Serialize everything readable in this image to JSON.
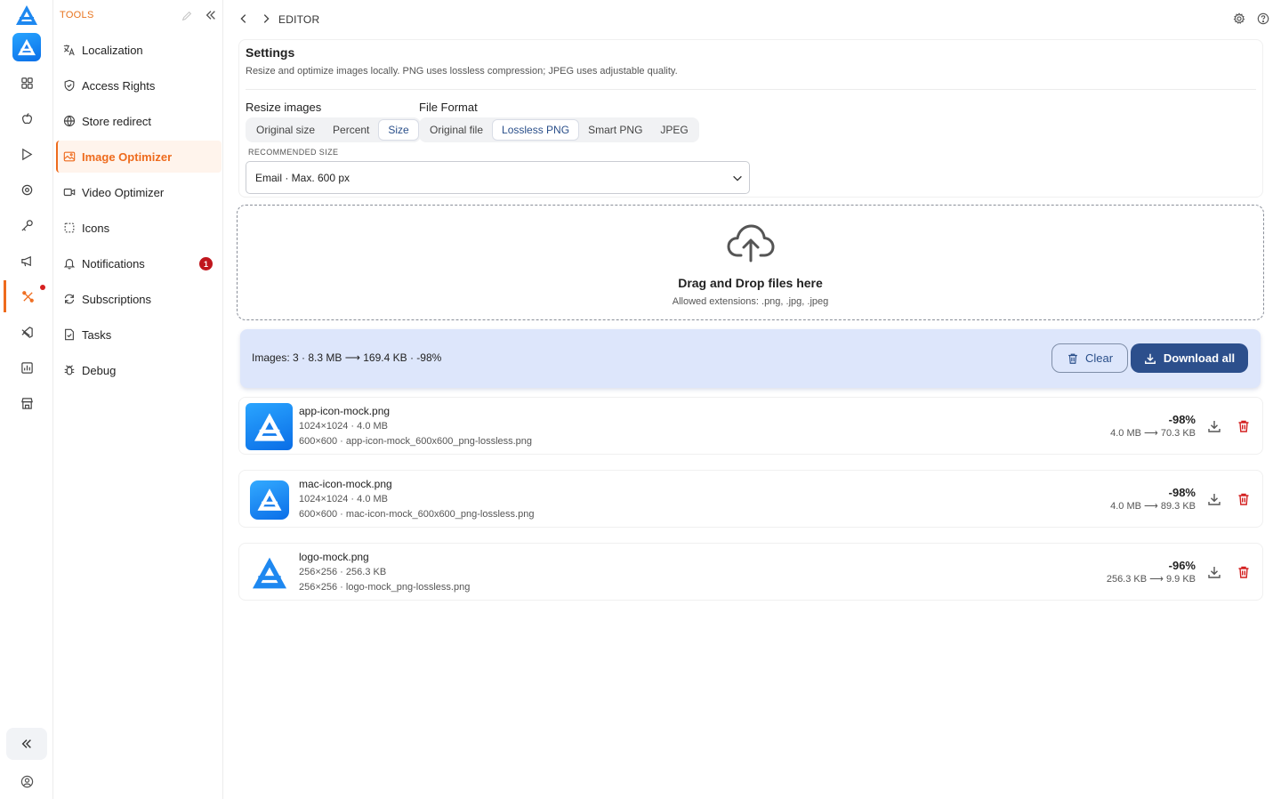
{
  "sidebar": {
    "heading": "TOOLS",
    "items": [
      {
        "label": "Localization",
        "icon": "translate-icon"
      },
      {
        "label": "Access Rights",
        "icon": "shield-icon"
      },
      {
        "label": "Store redirect",
        "icon": "globe-icon"
      },
      {
        "label": "Image Optimizer",
        "icon": "image-icon",
        "active": true
      },
      {
        "label": "Video Optimizer",
        "icon": "video-icon"
      },
      {
        "label": "Icons",
        "icon": "dashed-square-icon"
      },
      {
        "label": "Notifications",
        "icon": "bell-icon",
        "badge": "1"
      },
      {
        "label": "Subscriptions",
        "icon": "refresh-icon"
      },
      {
        "label": "Tasks",
        "icon": "task-file-icon"
      },
      {
        "label": "Debug",
        "icon": "bug-icon"
      }
    ]
  },
  "topbar": {
    "breadcrumb": "EDITOR"
  },
  "settings": {
    "title": "Settings",
    "description": "Resize and optimize images locally. PNG uses lossless compression; JPEG uses adjustable quality.",
    "resize": {
      "label": "Resize images",
      "options": [
        "Original size",
        "Percent",
        "Size"
      ],
      "selected": "Size"
    },
    "format": {
      "label": "File Format",
      "options": [
        "Original file",
        "Lossless PNG",
        "Smart PNG",
        "JPEG"
      ],
      "selected": "Lossless PNG"
    },
    "recommended": {
      "label": "RECOMMENDED SIZE",
      "value": "Email · Max. 600 px"
    }
  },
  "dropzone": {
    "title": "Drag and Drop files here",
    "subtitle": "Allowed extensions: .png, .jpg, .jpeg"
  },
  "summary": {
    "text": "Images: 3 · 8.3 MB ⟶ 169.4 KB · -98%",
    "clear_label": "Clear",
    "download_label": "Download all"
  },
  "files": [
    {
      "name": "app-icon-mock.png",
      "meta": "1024×1024 · 4.0 MB",
      "output": "600×600 · app-icon-mock_600x600_png-lossless.png",
      "percent": "-98%",
      "sizes": "4.0 MB ⟶ 70.3 KB"
    },
    {
      "name": "mac-icon-mock.png",
      "meta": "1024×1024 · 4.0 MB",
      "output": "600×600 · mac-icon-mock_600x600_png-lossless.png",
      "percent": "-98%",
      "sizes": "4.0 MB ⟶ 89.3 KB"
    },
    {
      "name": "logo-mock.png",
      "meta": "256×256 · 256.3 KB",
      "output": "256×256 · logo-mock_png-lossless.png",
      "percent": "-96%",
      "sizes": "256.3 KB ⟶ 9.9 KB"
    }
  ],
  "colors": {
    "accent": "#ee6b1d",
    "primary": "#2c4f8c",
    "summary_bg": "#dde6fb",
    "danger": "#d32020"
  }
}
